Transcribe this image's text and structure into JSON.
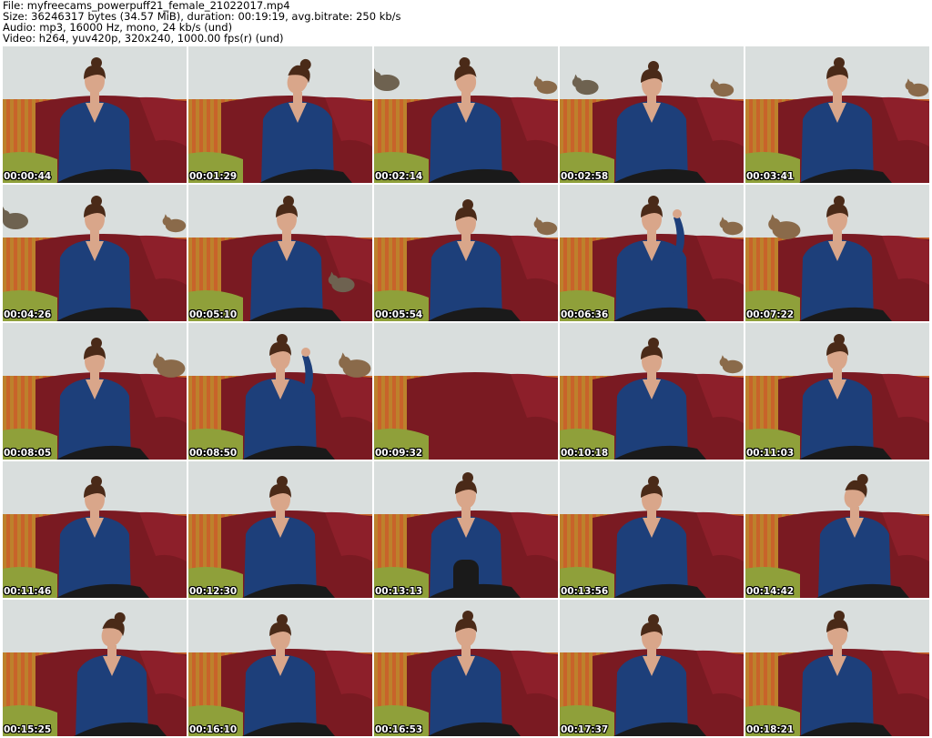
{
  "header": {
    "file_line": "File: myfreecams_powerpuff21_female_21022017.mp4",
    "size_line": "Size: 36246317 bytes (34.57 MiB), duration: 00:19:19, avg.bitrate: 250 kb/s",
    "audio_line": "Audio: mp3, 16000 Hz, mono, 24 kb/s (und)",
    "video_line": "Video: h264, yuv420p, 320x240, 1000.00 fps(r) (und)"
  },
  "colors": {
    "wall": "#d9dedd",
    "sofa_red": "#7a1a22",
    "sofa_stripe_orange": "#c8632a",
    "sofa_stripe_yellow": "#b59a2e",
    "cushion_green": "#8fa03a",
    "shirt_blue": "#1d3f7a",
    "skin": "#d9a68a",
    "hair": "#4a2a18",
    "pants_black": "#1a1a1a",
    "cat_tabby": "#6e6250",
    "cat_calico": "#8a6a4a"
  },
  "thumbnails": [
    {
      "time": "00:00:44",
      "pose": "center",
      "person": true,
      "cat": "none"
    },
    {
      "time": "00:01:29",
      "pose": "turned",
      "person": true,
      "cat": "none"
    },
    {
      "time": "00:02:14",
      "pose": "tilt",
      "person": true,
      "cat": "both"
    },
    {
      "time": "00:02:58",
      "pose": "down",
      "person": true,
      "cat": "right-pair"
    },
    {
      "time": "00:03:41",
      "pose": "center",
      "person": true,
      "cat": "right"
    },
    {
      "time": "00:04:26",
      "pose": "center",
      "person": true,
      "cat": "both"
    },
    {
      "time": "00:05:10",
      "pose": "smile",
      "person": true,
      "cat": "right-low"
    },
    {
      "time": "00:05:54",
      "pose": "down",
      "person": true,
      "cat": "right"
    },
    {
      "time": "00:06:36",
      "pose": "hand",
      "person": true,
      "cat": "right"
    },
    {
      "time": "00:07:22",
      "pose": "center",
      "person": true,
      "cat": "top-walk"
    },
    {
      "time": "00:08:05",
      "pose": "down",
      "person": true,
      "cat": "right-walk"
    },
    {
      "time": "00:08:50",
      "pose": "hand",
      "person": true,
      "cat": "right-walk"
    },
    {
      "time": "00:09:32",
      "pose": "empty",
      "person": false,
      "cat": "none"
    },
    {
      "time": "00:10:18",
      "pose": "down",
      "person": true,
      "cat": "right"
    },
    {
      "time": "00:11:03",
      "pose": "center",
      "person": true,
      "cat": "none"
    },
    {
      "time": "00:11:46",
      "pose": "down",
      "person": true,
      "cat": "none"
    },
    {
      "time": "00:12:30",
      "pose": "down",
      "person": true,
      "cat": "none"
    },
    {
      "time": "00:13:13",
      "pose": "knees",
      "person": true,
      "cat": "none"
    },
    {
      "time": "00:13:56",
      "pose": "down",
      "person": true,
      "cat": "none"
    },
    {
      "time": "00:14:42",
      "pose": "turned",
      "person": true,
      "cat": "none"
    },
    {
      "time": "00:15:25",
      "pose": "turned",
      "person": true,
      "cat": "none"
    },
    {
      "time": "00:16:10",
      "pose": "down",
      "person": true,
      "cat": "none"
    },
    {
      "time": "00:16:53",
      "pose": "center",
      "person": true,
      "cat": "none"
    },
    {
      "time": "00:17:37",
      "pose": "down",
      "person": true,
      "cat": "none"
    },
    {
      "time": "00:18:21",
      "pose": "center",
      "person": true,
      "cat": "none"
    }
  ]
}
